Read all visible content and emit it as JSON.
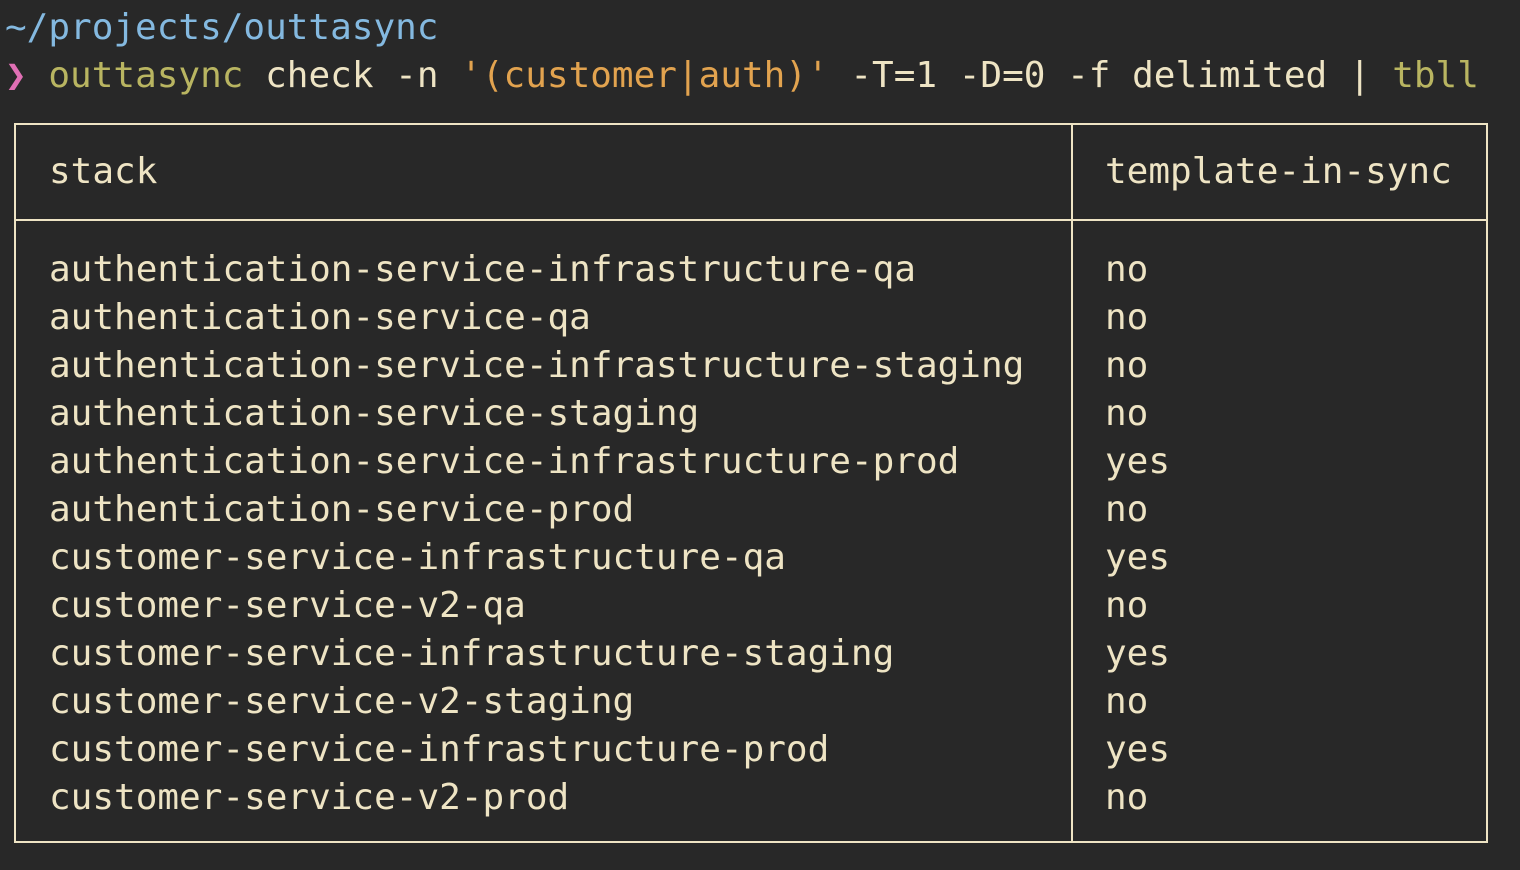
{
  "terminal": {
    "cwd": "~/projects/outtasync",
    "prompt_symbol": "❯",
    "command": {
      "name": "outtasync",
      "args_before_string": " check -n ",
      "string_arg": "'(customer|auth)'",
      "args_after_string": " -T=1 -D=0 -f delimited ",
      "pipe": "| ",
      "pipe_tool": "tbll"
    },
    "colors": {
      "background": "#282828",
      "foreground": "#eee4c4",
      "cwd": "#84b9e0",
      "prompt": "#e06fb4",
      "command": "#b9b561",
      "string": "#e2a34f"
    }
  },
  "table": {
    "headers": [
      "stack",
      "template-in-sync"
    ],
    "rows": [
      [
        "authentication-service-infrastructure-qa",
        "no"
      ],
      [
        "authentication-service-qa",
        "no"
      ],
      [
        "authentication-service-infrastructure-staging",
        "no"
      ],
      [
        "authentication-service-staging",
        "no"
      ],
      [
        "authentication-service-infrastructure-prod",
        "yes"
      ],
      [
        "authentication-service-prod",
        "no"
      ],
      [
        "customer-service-infrastructure-qa",
        "yes"
      ],
      [
        "customer-service-v2-qa",
        "no"
      ],
      [
        "customer-service-infrastructure-staging",
        "yes"
      ],
      [
        "customer-service-v2-staging",
        "no"
      ],
      [
        "customer-service-infrastructure-prod",
        "yes"
      ],
      [
        "customer-service-v2-prod",
        "no"
      ]
    ]
  }
}
